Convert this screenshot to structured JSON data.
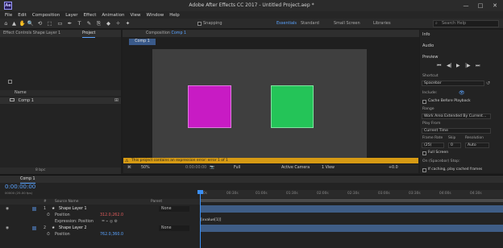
{
  "app": {
    "icon_text": "Ae",
    "title": "Adobe After Effects CC 2017 - Untitled Project.aep *",
    "window_controls": [
      "—",
      "□",
      "✕"
    ]
  },
  "menu": [
    "File",
    "Edit",
    "Composition",
    "Layer",
    "Effect",
    "Animation",
    "View",
    "Window",
    "Help"
  ],
  "toolbar": {
    "tools": [
      "⌂",
      "▲",
      "✋",
      "🔍",
      "⟲",
      "⬚",
      "▭",
      "✒",
      "T",
      "✎",
      "⎘",
      "◆",
      "✧",
      "✦"
    ],
    "snapping_label": "Snapping",
    "workspaces": [
      "Essentials",
      "Standard",
      "Small Screen",
      "Libraries"
    ],
    "active_workspace": "Essentials",
    "search_placeholder": "Search Help"
  },
  "left_panel": {
    "tabs": [
      "Effect Controls Shape Layer 1",
      "Project"
    ],
    "active_tab": "Project",
    "search_icon": "⌕",
    "columns": {
      "name": "Name"
    },
    "item": "Comp 1",
    "footer_bpc": "8 bpc"
  },
  "composition": {
    "tab_label": "Composition",
    "tab_link": "Comp 1",
    "breadcrumb": "Comp 1",
    "warning": "This project contains an expression error: error 1 of 1",
    "zoom": "50%",
    "timecode": "0:00:00:00",
    "resolution": "Full",
    "camera": "Active Camera",
    "views": "1 View",
    "exposure": "+0.0"
  },
  "right_panel": {
    "info_label": "Info",
    "audio_label": "Audio",
    "preview_label": "Preview",
    "playback_buttons": [
      "⏮",
      "◀|",
      "▶",
      "|▶",
      "⏭"
    ],
    "shortcut_label": "Shortcut",
    "shortcut_value": "Spacebar",
    "include_label": "Include:",
    "cache_before_playback": "Cache Before Playback",
    "range_label": "Range",
    "range_value": "Work Area Extended By Current...",
    "play_from_label": "Play From",
    "play_from_value": "Current Time",
    "frame_rate_label": "Frame Rate",
    "frame_rate_value": "(25)",
    "skip_label": "Skip",
    "skip_value": "0",
    "resolution_label": "Resolution",
    "resolution_value": "Auto",
    "full_screen": "Full Screen",
    "on_stop_label": "On (Spacebar) Stop:",
    "if_caching": "If caching, play cached frames"
  },
  "timeline": {
    "tab_label": "Comp 1",
    "timecode": "0:00:00:00",
    "fps_label": "00000 (25.00 fps)",
    "columns": {
      "num": "#",
      "source": "Source Name",
      "parent": "Parent"
    },
    "ruler": [
      "0s",
      "00:30s",
      "01:00s",
      "01:30s",
      "02:00s",
      "02:30s",
      "03:00s",
      "03:30s",
      "04:00s",
      "04:30s"
    ],
    "layers": [
      {
        "num": "1",
        "name": "Shape Layer 1",
        "parent": "None",
        "color": "#3f5d86"
      },
      {
        "num": "2",
        "name": "Shape Layer 2",
        "parent": "None",
        "color": "#3f5d86"
      }
    ],
    "props": {
      "position": "Position",
      "position1_value": "312.0,262.0",
      "expression_label": "Expression: Position",
      "expression_text": "[xvalue[1]]",
      "position2_value": "762.0,360.0"
    }
  },
  "colors": {
    "accent": "#5aa3ff",
    "warning": "#d69a14",
    "magenta_shape": "#c81bc4",
    "green_shape": "#24c458",
    "error_value": "#e25d5d"
  }
}
